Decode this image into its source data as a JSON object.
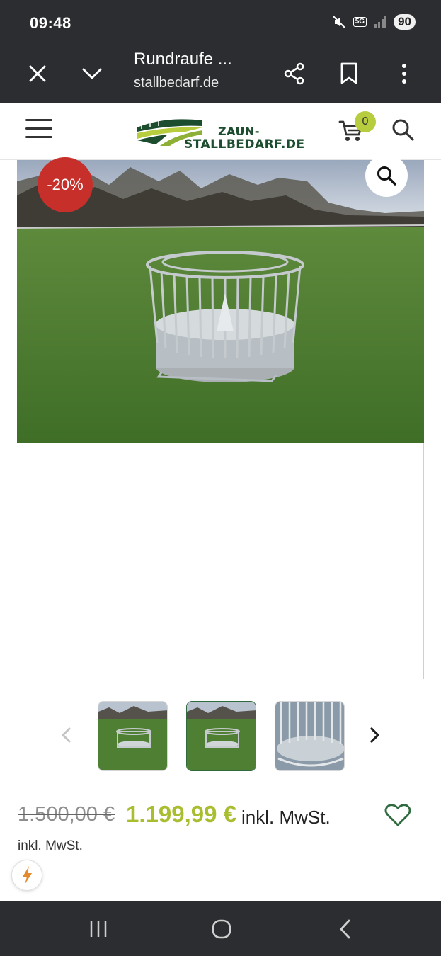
{
  "status_bar": {
    "time": "09:48",
    "network": "5G",
    "battery": "90",
    "icons": [
      "mute-icon",
      "signal-icon"
    ]
  },
  "browser_toolbar": {
    "title": "Rundraufe ...",
    "url": "stallbedarf.de",
    "icons": [
      "close-icon",
      "chevron-down-icon",
      "share-icon",
      "bookmark-icon",
      "more-vert-icon"
    ]
  },
  "site_header": {
    "logo_line1": "ZAUN-",
    "logo_line2": "STALLBEDARF.DE",
    "cart_count": "0",
    "icons": [
      "menu-icon",
      "cart-icon",
      "search-icon"
    ],
    "colors": {
      "logo_green": "#1d4d2f",
      "accent": "#b7cd3e"
    }
  },
  "product": {
    "discount_badge": "-20%",
    "old_price": "1.500,00 €",
    "new_price": "1.199,99 €",
    "tax_inline": "inkl. MwSt.",
    "tax_note": "inkl. MwSt.",
    "colors": {
      "price_green": "#a9bd2f",
      "badge_red": "#c7302a"
    }
  },
  "thumbnails": [
    {
      "active": false
    },
    {
      "active": true
    },
    {
      "active": false
    }
  ],
  "nav_bar": {
    "icons": [
      "recent-apps-icon",
      "home-icon",
      "back-icon"
    ]
  }
}
